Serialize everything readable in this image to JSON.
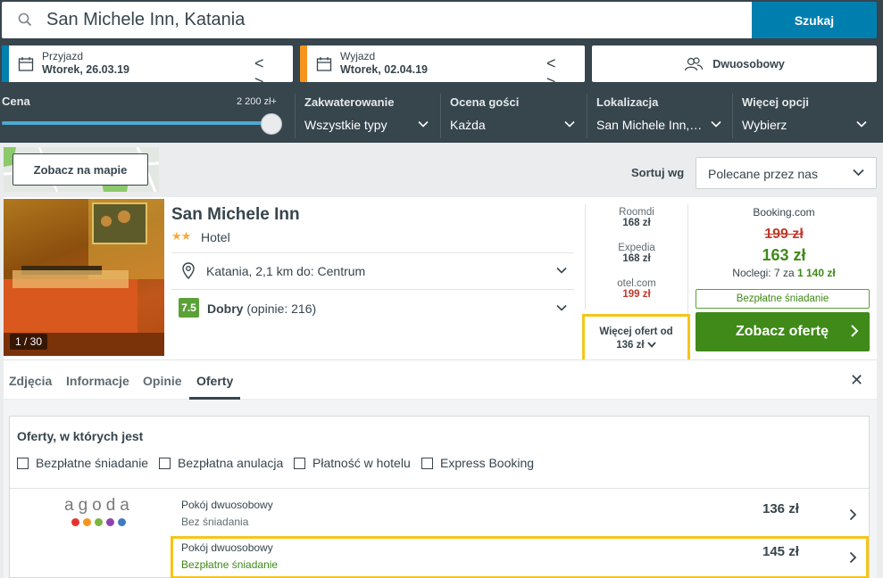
{
  "search": {
    "query": "San Michele Inn, Katania",
    "button_label": "Szukaj"
  },
  "dates": {
    "checkin_label": "Przyjazd",
    "checkin_value": "Wtorek, 26.03.19",
    "checkout_label": "Wyjazd",
    "checkout_value": "Wtorek, 02.04.19",
    "prev_next": "< >",
    "stripe_checkin": "#007faf",
    "stripe_checkout": "#f7941d"
  },
  "guests": {
    "label": "Dwuosobowy"
  },
  "filters": {
    "price_label": "Cena",
    "price_max": "2 200 zł+",
    "price_fraction": 1.0,
    "items": [
      {
        "title": "Zakwaterowanie",
        "value": "Wszystkie typy"
      },
      {
        "title": "Ocena gości",
        "value": "Każda"
      },
      {
        "title": "Lokalizacja",
        "value": "San Michele Inn,…"
      },
      {
        "title": "Więcej opcji",
        "value": "Wybierz"
      }
    ]
  },
  "map": {
    "button_label": "Zobacz na mapie"
  },
  "sort": {
    "label": "Sortuj wg",
    "value": "Polecane przez nas"
  },
  "hotel": {
    "name": "San Michele Inn",
    "stars": "★★",
    "type": "Hotel",
    "photo_counter": "1 / 30",
    "location": "Katania, 2,1 km do: Centrum",
    "rating_score": "7.5",
    "rating_word": "Dobry",
    "rating_reviews": "(opinie: 216)",
    "mini_deals": [
      {
        "name": "Roomdi",
        "price": "168 zł",
        "color": "#37454d"
      },
      {
        "name": "Expedia",
        "price": "168 zł",
        "color": "#37454d"
      },
      {
        "name": "otel.com",
        "price": "199 zł",
        "color": "#c0392b"
      }
    ],
    "more_offers_label": "Więcej ofert od",
    "more_offers_price": "136 zł",
    "main_deal": {
      "provider": "Booking.com",
      "old_price": "199 zł",
      "new_price": "163 zł",
      "nights_text": "Noclegi: 7 za",
      "nights_total": "1 140 zł",
      "badge": "Bezpłatne śniadanie",
      "button_label": "Zobacz ofertę"
    }
  },
  "tabs": [
    {
      "label": "Zdjęcia"
    },
    {
      "label": "Informacje"
    },
    {
      "label": "Opinie"
    },
    {
      "label": "Oferty"
    }
  ],
  "offers": {
    "title": "Oferty, w których jest",
    "checkboxes": [
      {
        "label": "Bezpłatne śniadanie"
      },
      {
        "label": "Bezpłatna anulacja"
      },
      {
        "label": "Płatność w hotelu"
      },
      {
        "label": "Express Booking"
      }
    ],
    "provider": {
      "name": "agoda",
      "dot_colors": [
        "#e8322f",
        "#f7941d",
        "#7cb342",
        "#8e44ad",
        "#3f7ac3"
      ]
    },
    "rows": [
      {
        "room": "Pokój dwuosobowy",
        "meal": "Bez śniadania",
        "price": "136 zł"
      },
      {
        "room": "Pokój dwuosobowy",
        "meal": "Bezpłatne śniadanie",
        "price": "145 zł"
      }
    ]
  }
}
